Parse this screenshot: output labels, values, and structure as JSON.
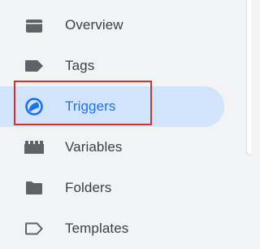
{
  "sidebar": {
    "items": [
      {
        "id": "overview",
        "label": "Overview",
        "icon": "briefcase-icon",
        "active": false
      },
      {
        "id": "tags",
        "label": "Tags",
        "icon": "tag-icon",
        "active": false
      },
      {
        "id": "triggers",
        "label": "Triggers",
        "icon": "trigger-icon",
        "active": true
      },
      {
        "id": "variables",
        "label": "Variables",
        "icon": "lego-brick-icon",
        "active": false
      },
      {
        "id": "folders",
        "label": "Folders",
        "icon": "folder-icon",
        "active": false
      },
      {
        "id": "templates",
        "label": "Templates",
        "icon": "label-outline-icon",
        "active": false
      }
    ]
  },
  "colors": {
    "active_background": "#d2e3fc",
    "active_text": "#1a73e8",
    "icon": "#5f6368",
    "highlight_border": "#d93025"
  }
}
